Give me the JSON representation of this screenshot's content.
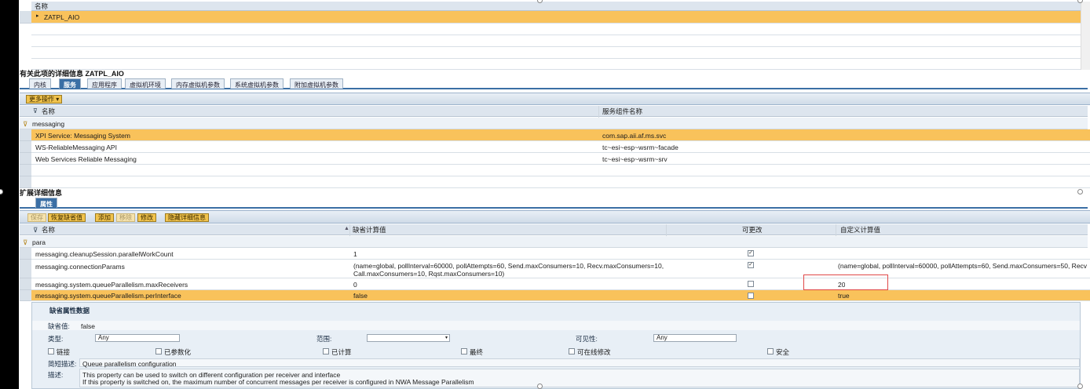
{
  "top_table": {
    "header": "名称",
    "selected_row": "ZATPL_AIO"
  },
  "details": {
    "title": "有关此项的详细信息 ZATPL_AIO",
    "tabs": [
      "内核",
      "服务",
      "应用程序",
      "虚拟机环境",
      "内存虚拟机参数",
      "系统虚拟机参数",
      "附加虚拟机参数"
    ],
    "active_tab": "服务",
    "more_actions": "更多操作",
    "columns": [
      "名称",
      "服务组件名称"
    ],
    "filter_value": "messaging",
    "rows": [
      {
        "name": "XPI Service: Messaging System",
        "component": "com.sap.aii.af.ms.svc",
        "selected": true
      },
      {
        "name": "WS-ReliableMessaging API",
        "component": "tc~esi~esp~wsrm~facade",
        "selected": false
      },
      {
        "name": "Web Services Reliable Messaging",
        "component": "tc~esi~esp~wsrm~srv",
        "selected": false
      }
    ]
  },
  "extended": {
    "title": "扩展详细信息",
    "tab": "属性",
    "toolbar": {
      "save": "保存",
      "restore": "恢复缺省值",
      "add": "添加",
      "remove": "移除",
      "modify": "修改",
      "hide_details": "隐藏详细信息"
    },
    "columns": [
      "名称",
      "缺省计算值",
      "可更改",
      "自定义计算值"
    ],
    "filter_value": "para",
    "rows": [
      {
        "name": "messaging.cleanupSession.parallelWorkCount",
        "default": "1",
        "default2": "",
        "changeable": true,
        "custom": "",
        "selected": false
      },
      {
        "name": "messaging.connectionParams",
        "default": "(name=global, pollInterval=60000, pollAttempts=60, Send.maxConsumers=10, Recv.maxConsumers=10,",
        "default2": "Call.maxConsumers=10, Rqst.maxConsumers=10)",
        "changeable": true,
        "custom": "(name=global, pollInterval=60000, pollAttempts=60, Send.maxConsumers=50, Recv",
        "selected": false
      },
      {
        "name": "messaging.system.queueParallelism.maxReceivers",
        "default": "0",
        "default2": "",
        "changeable": false,
        "custom": "20",
        "selected": false
      },
      {
        "name": "messaging.system.queueParallelism.perInterface",
        "default": "false",
        "default2": "",
        "changeable": false,
        "custom": "true",
        "selected": true
      }
    ]
  },
  "default_props": {
    "title": "缺省属性数据",
    "default_value_label": "缺省值:",
    "default_value": "false",
    "type_label": "类型:",
    "type_value": "Any",
    "range_label": "范围:",
    "visibility_label": "可见性:",
    "visibility_value": "Any",
    "flags": [
      "链接",
      "已参数化",
      "已计算",
      "最终",
      "可在线修改",
      "安全"
    ],
    "short_desc_label": "简短描述:",
    "short_desc": "Queue parallelism configuration",
    "desc_label": "描述:",
    "desc_line1": "This property can be used to switch on different configuration per receiver and interface",
    "desc_line2": "If this property is switched on, the maximum number of concurrent messages per receiver is configured in NWA Message Parallelism"
  },
  "colors": {
    "selected_row": "#f9c25b",
    "tab_active": "#3b6fa5",
    "highlight_box": "#e04848"
  }
}
